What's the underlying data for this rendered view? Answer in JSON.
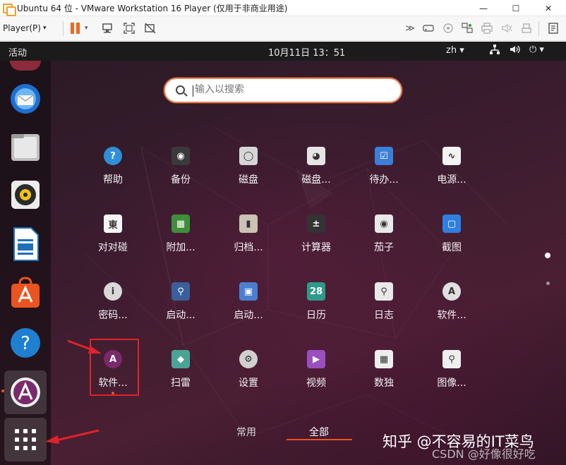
{
  "window": {
    "title": "Ubuntu 64 位 - VMware Workstation 16 Player (仅用于非商业用途)",
    "min": "—",
    "max": "☐",
    "close": "✕"
  },
  "toolbar": {
    "player_label": "Player(P)",
    "caret": "▾",
    "right_icons": [
      "fast-forward-icon",
      "removable-device-icon",
      "network-icon",
      "usb-icon",
      "printer-icon",
      "sound-icon",
      "hard-disk-icon",
      "notes-icon"
    ]
  },
  "topbar": {
    "activities": "活动",
    "clock": "10月11日  13：51",
    "lang": "zh ▾",
    "network_icon": "⊤",
    "volume_icon": "◀)",
    "power_icon": "⏻ ▾"
  },
  "search": {
    "placeholder": "输入以搜索"
  },
  "apps": [
    {
      "label": "帮助",
      "icon": "help-icon",
      "color": "#2f8fd8",
      "glyph": "?"
    },
    {
      "label": "备份",
      "icon": "backup-icon",
      "color": "#3a3a3a",
      "glyph": "◉"
    },
    {
      "label": "磁盘",
      "icon": "disks-icon",
      "color": "#d6d6d6",
      "glyph": "◯"
    },
    {
      "label": "磁盘...",
      "icon": "disk-usage-icon",
      "color": "#e5e5e5",
      "glyph": "◕"
    },
    {
      "label": "待办...",
      "icon": "todo-icon",
      "color": "#3c7fd9",
      "glyph": "☑"
    },
    {
      "label": "电源...",
      "icon": "power-stats-icon",
      "color": "#f3f3f3",
      "glyph": "∿"
    },
    {
      "label": "对对碰",
      "icon": "mahjongg-icon",
      "color": "#f5f5f5",
      "glyph": "東"
    },
    {
      "label": "附加...",
      "icon": "additional-drivers-icon",
      "color": "#3f8f3a",
      "glyph": "▦"
    },
    {
      "label": "归档...",
      "icon": "archive-manager-icon",
      "color": "#ccc2b3",
      "glyph": "▮"
    },
    {
      "label": "计算器",
      "icon": "calculator-icon",
      "color": "#333333",
      "glyph": "±"
    },
    {
      "label": "茄子",
      "icon": "cheese-icon",
      "color": "#e8e8e8",
      "glyph": "◉"
    },
    {
      "label": "截图",
      "icon": "screenshot-icon",
      "color": "#2f7fe0",
      "glyph": "▢"
    },
    {
      "label": "密码...",
      "icon": "passwords-icon",
      "color": "#d8d8d8",
      "glyph": "i"
    },
    {
      "label": "启动...",
      "icon": "startup-disk-icon",
      "color": "#3a5f9a",
      "glyph": "⚲"
    },
    {
      "label": "启动...",
      "icon": "startup-apps-icon",
      "color": "#4a7fd0",
      "glyph": "▣"
    },
    {
      "label": "日历",
      "icon": "calendar-icon",
      "color": "#2e9a8a",
      "glyph": "28"
    },
    {
      "label": "日志",
      "icon": "logs-icon",
      "color": "#e8e8e8",
      "glyph": "⚲"
    },
    {
      "label": "软件...",
      "icon": "software-updater-icon",
      "color": "#e0e0e0",
      "glyph": "A"
    },
    {
      "label": "软件...",
      "icon": "software-properties-icon",
      "color": "#7a2a6a",
      "glyph": "A"
    },
    {
      "label": "扫雷",
      "icon": "mines-icon",
      "color": "#4aa394",
      "glyph": "◆"
    },
    {
      "label": "设置",
      "icon": "settings-icon",
      "color": "#d0d0d0",
      "glyph": "⚙"
    },
    {
      "label": "视频",
      "icon": "videos-icon",
      "color": "#9a4ec0",
      "glyph": "▶"
    },
    {
      "label": "数独",
      "icon": "sudoku-icon",
      "color": "#eeeeee",
      "glyph": "▦"
    },
    {
      "label": "图像...",
      "icon": "image-viewer-icon",
      "color": "#efefef",
      "glyph": "⚲"
    }
  ],
  "tabs": {
    "frequent": "常用",
    "all": "全部"
  },
  "dock": [
    "thunderbird-icon",
    "files-icon",
    "rhythmbox-icon",
    "writer-icon",
    "software-center-icon",
    "help-icon",
    "software-properties-icon",
    "show-apps-icon"
  ],
  "watermark": {
    "zhihu": "知乎 @不容易的IT菜鸟",
    "csdn": "CSDN @好像很好吃"
  }
}
